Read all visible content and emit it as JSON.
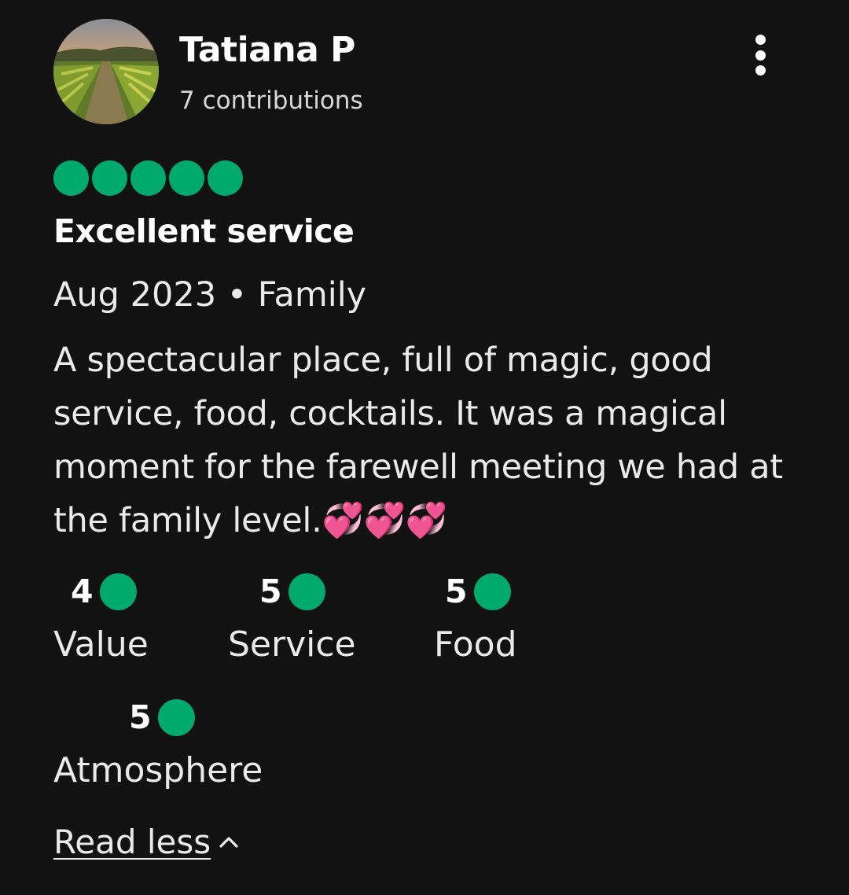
{
  "review": {
    "user_name": "Tatiana P",
    "contributions": "7 contributions",
    "rating": 5,
    "title": "Excellent service",
    "meta": "Aug 2023 • Family",
    "body": "A spectacular place, full of magic, good service, food, cocktails. It was a magical moment for the farewell meeting we had at the family level.💞💞💞",
    "subratings": [
      {
        "score": "4",
        "label": "Value"
      },
      {
        "score": "5",
        "label": "Service"
      },
      {
        "score": "5",
        "label": "Food"
      },
      {
        "score": "5",
        "label": "Atmosphere"
      }
    ],
    "read_less_label": "Read less"
  },
  "icons": {
    "more": "more-vertical-icon",
    "chevron": "chevron-up-icon",
    "bubble": "rating-bubble-icon"
  },
  "colors": {
    "background": "#121212",
    "accent_green": "#00aa6c",
    "text": "#eaeaea"
  }
}
